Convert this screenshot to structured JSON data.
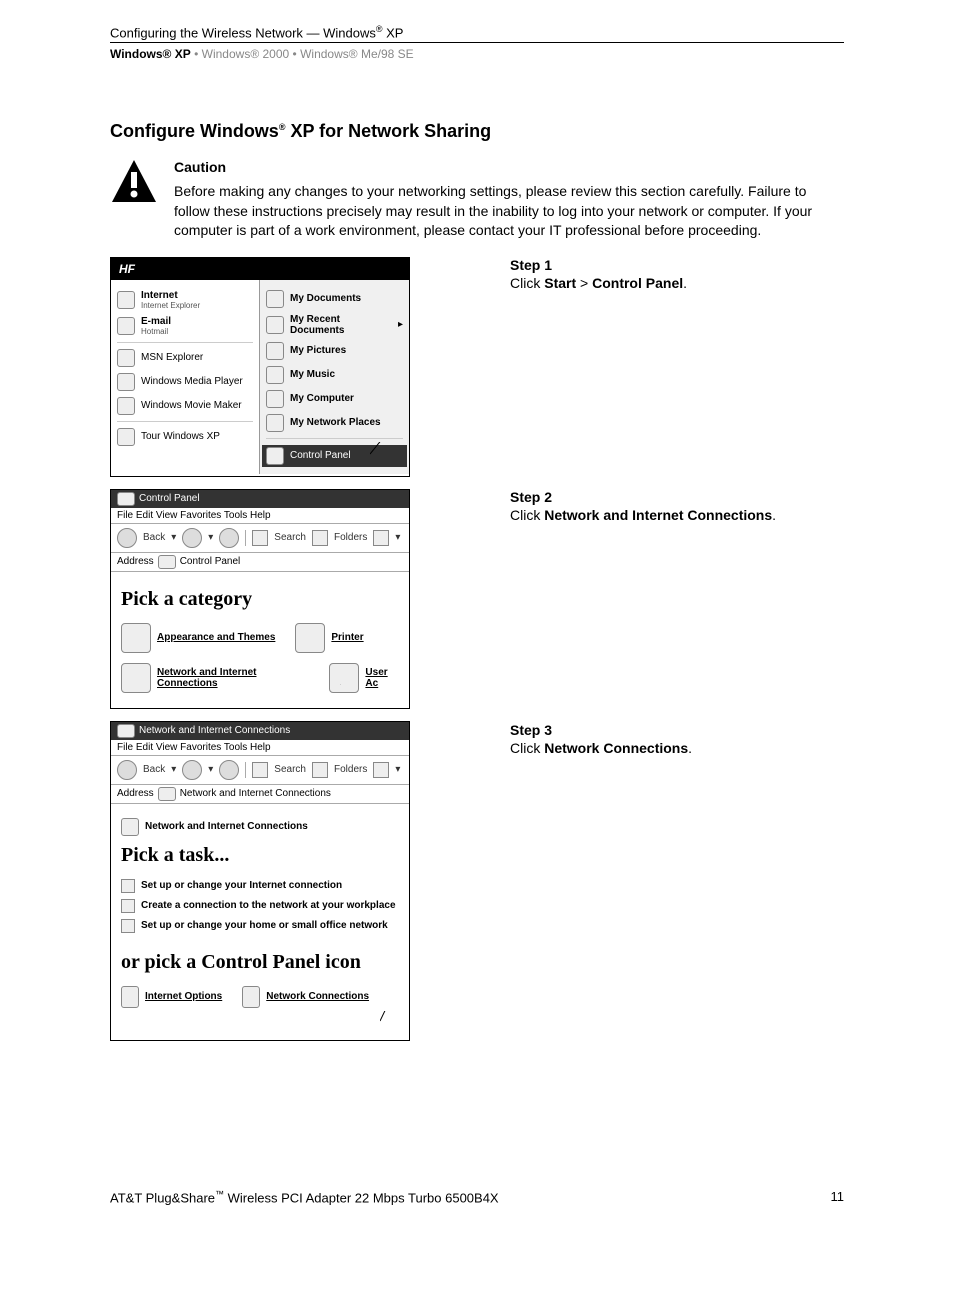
{
  "header": {
    "breadcrumb_left": "Configuring the Wireless Network — Windows",
    "breadcrumb_right_os": " XP",
    "tabs": {
      "active": "Windows® XP",
      "t2": "Windows® 2000",
      "t3": "Windows® Me/98 SE",
      "sep": " • "
    }
  },
  "title": {
    "pre": "Configure Windows",
    "post": " XP for Network Sharing"
  },
  "caution": {
    "heading": "Caution",
    "body": "Before making any changes to your networking settings, please review this section carefully. Failure to follow these instructions precisely may result in the inability to log into your network or computer. If your computer is part of a work environment, please contact your IT professional before proceeding."
  },
  "steps": {
    "s1": {
      "title": "Step 1",
      "pre": "Click ",
      "b1": "Start",
      "mid": " > ",
      "b2": "Control Panel",
      "post": "."
    },
    "s2": {
      "title": "Step 2",
      "pre": "Click ",
      "b1": "Network and Internet Connections",
      "post": "."
    },
    "s3": {
      "title": "Step 3",
      "pre": "Click ",
      "b1": "Network Connections",
      "post": "."
    }
  },
  "shot1": {
    "user": "HF",
    "left": {
      "internet": "Internet",
      "internet_sub": "Internet Explorer",
      "email": "E-mail",
      "email_sub": "Hotmail",
      "msn": "MSN Explorer",
      "wmp": "Windows Media Player",
      "mm": "Windows Movie Maker",
      "tour": "Tour Windows XP"
    },
    "right": {
      "docs": "My Documents",
      "recent": "My Recent Documents",
      "pics": "My Pictures",
      "music": "My Music",
      "comp": "My Computer",
      "net": "My Network Places",
      "cp": "Control Panel"
    }
  },
  "shot2": {
    "title": "Control Panel",
    "menu": "File   Edit   View   Favorites   Tools   Help",
    "back": "Back",
    "search": "Search",
    "folders": "Folders",
    "addr_label": "Address",
    "addr_val": "Control Panel",
    "pick": "Pick a category",
    "cat1": "Appearance and Themes",
    "cat2": "Network and Internet Connections",
    "cat3": "Printer",
    "cat4": "User Ac"
  },
  "shot3": {
    "title": "Network and Internet Connections",
    "menu": "File   Edit   View   Favorites   Tools   Help",
    "back": "Back",
    "search": "Search",
    "folders": "Folders",
    "addr_label": "Address",
    "addr_val": "Network and Internet Connections",
    "head": "Network and Internet Connections",
    "pick_task": "Pick a task...",
    "task1": "Set up or change your Internet connection",
    "task2": "Create a connection to the network at your workplace",
    "task3": "Set up or change your home or small office network",
    "pick_icon": "or pick a Control Panel icon",
    "icon1": "Internet Options",
    "icon2": "Network Connections"
  },
  "footer": {
    "left_pre": "AT&T Plug&Share",
    "left_post": " Wireless PCI Adapter 22 Mbps Turbo 6500B4X",
    "page": "11"
  }
}
